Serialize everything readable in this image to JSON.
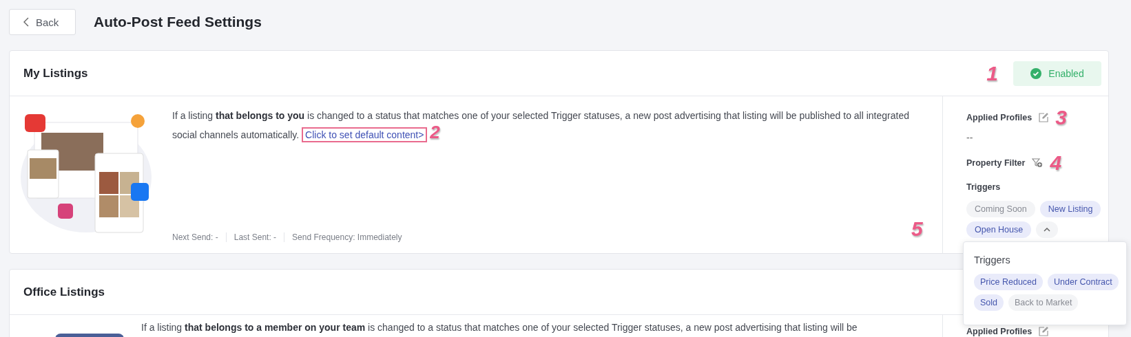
{
  "header": {
    "back_button": "Back",
    "title": "Auto-Post Feed Settings"
  },
  "sections": [
    {
      "title": "My Listings",
      "status": {
        "label": "Enabled",
        "enabled": true,
        "marker": "1"
      },
      "description": "If a listing **that belongs to you** is changed to a status that matches one of your selected Trigger statuses, a new post advertising that listing will be published to all integrated social channels automatically.",
      "link": {
        "label": "Click to set default content>",
        "highlighted": true,
        "marker": "2"
      },
      "stats": [
        {
          "label": "Next Send:",
          "value": "-"
        },
        {
          "label": "Last Sent:",
          "value": "-"
        },
        {
          "label": "Send Frequency:",
          "value": "Immediately"
        }
      ],
      "applied_profiles": {
        "label": "Applied Profiles",
        "value": "--",
        "marker": "3"
      },
      "property_filter": {
        "label": "Property Filter",
        "marker": "4"
      },
      "triggers": {
        "label": "Triggers",
        "marker": "5",
        "expanded": true,
        "items": [
          {
            "label": "Coming Soon",
            "selected": false
          },
          {
            "label": "New Listing",
            "selected": true
          },
          {
            "label": "Open House",
            "selected": true
          }
        ]
      }
    },
    {
      "title": "Office Listings",
      "description": "If a listing **that belongs to a member on your team** is changed to a status that matches one of your selected Trigger statuses, a new post advertising that listing will be",
      "applied_profiles": {
        "label": "Applied Profiles"
      }
    }
  ],
  "popover": {
    "title": "Triggers",
    "items": [
      {
        "label": "Price Reduced",
        "selected": true
      },
      {
        "label": "Under Contract",
        "selected": true
      },
      {
        "label": "Sold",
        "selected": true
      },
      {
        "label": "Back to Market",
        "selected": false
      }
    ]
  }
}
